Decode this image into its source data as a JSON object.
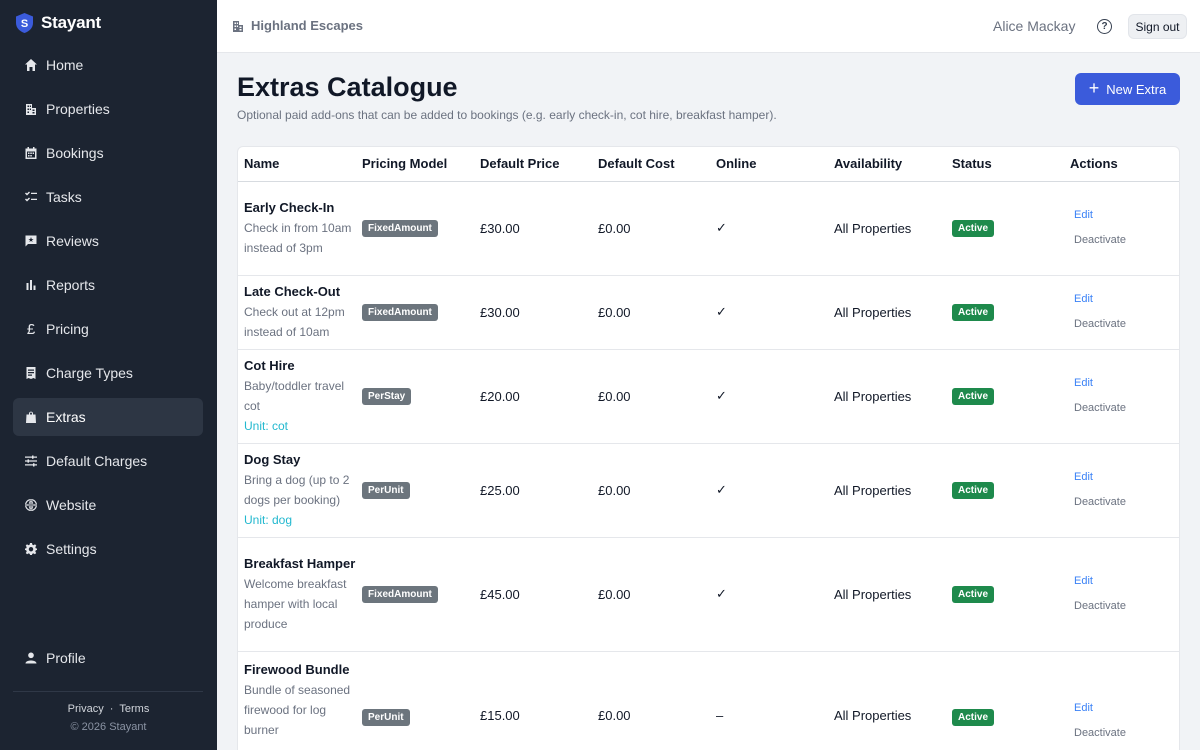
{
  "app": {
    "name": "Stayant"
  },
  "sidebar": {
    "items": [
      {
        "label": "Home",
        "icon": "home-icon"
      },
      {
        "label": "Properties",
        "icon": "building-icon"
      },
      {
        "label": "Bookings",
        "icon": "calendar-icon"
      },
      {
        "label": "Tasks",
        "icon": "checklist-icon"
      },
      {
        "label": "Reviews",
        "icon": "review-icon"
      },
      {
        "label": "Reports",
        "icon": "bar-chart-icon"
      },
      {
        "label": "Pricing",
        "icon": "pound-icon"
      },
      {
        "label": "Charge Types",
        "icon": "receipt-icon"
      },
      {
        "label": "Extras",
        "icon": "bag-icon",
        "active": true
      },
      {
        "label": "Default Charges",
        "icon": "sliders-icon"
      },
      {
        "label": "Website",
        "icon": "globe-icon"
      },
      {
        "label": "Settings",
        "icon": "gear-icon"
      }
    ],
    "profile": "Profile",
    "footer": {
      "privacy": "Privacy",
      "separator": "·",
      "terms": "Terms",
      "copyright": "© 2026 Stayant"
    }
  },
  "topbar": {
    "org": "Highland Escapes",
    "user": "Alice Mackay",
    "help": "?",
    "signout": "Sign out"
  },
  "page": {
    "title": "Extras Catalogue",
    "subtitle": "Optional paid add-ons that can be added to bookings (e.g. early check-in, cot hire, breakfast hamper).",
    "new_button": "New Extra"
  },
  "table": {
    "headers": [
      "Name",
      "Pricing Model",
      "Default Price",
      "Default Cost",
      "Online",
      "Availability",
      "Status",
      "Actions"
    ],
    "rows": [
      {
        "name": "Early Check-In",
        "desc": "Check in from 10am instead of 3pm",
        "unit": "",
        "model": "FixedAmount",
        "price": "£30.00",
        "cost": "£0.00",
        "online": "✓",
        "availability": "All Properties",
        "status": "Active",
        "edit": "Edit",
        "deactivate": "Deactivate"
      },
      {
        "name": "Late Check-Out",
        "desc": "Check out at 12pm instead of 10am",
        "unit": "",
        "model": "FixedAmount",
        "price": "£30.00",
        "cost": "£0.00",
        "online": "✓",
        "availability": "All Properties",
        "status": "Active",
        "edit": "Edit",
        "deactivate": "Deactivate"
      },
      {
        "name": "Cot Hire",
        "desc": "Baby/toddler travel cot",
        "unit": "Unit: cot",
        "model": "PerStay",
        "price": "£20.00",
        "cost": "£0.00",
        "online": "✓",
        "availability": "All Properties",
        "status": "Active",
        "edit": "Edit",
        "deactivate": "Deactivate"
      },
      {
        "name": "Dog Stay",
        "desc": "Bring a dog (up to 2 dogs per booking)",
        "unit": "Unit: dog",
        "model": "PerUnit",
        "price": "£25.00",
        "cost": "£0.00",
        "online": "✓",
        "availability": "All Properties",
        "status": "Active",
        "edit": "Edit",
        "deactivate": "Deactivate"
      },
      {
        "name": "Breakfast Hamper",
        "desc": "Welcome breakfast hamper with local produce",
        "unit": "",
        "model": "FixedAmount",
        "price": "£45.00",
        "cost": "£0.00",
        "online": "✓",
        "availability": "All Properties",
        "status": "Active",
        "edit": "Edit",
        "deactivate": "Deactivate"
      },
      {
        "name": "Firewood Bundle",
        "desc": "Bundle of seasoned firewood for log burner",
        "unit": "",
        "model": "PerUnit",
        "price": "£15.00",
        "cost": "£0.00",
        "online": "–",
        "availability": "All Properties",
        "status": "Active",
        "edit": "Edit",
        "deactivate": "Deactivate"
      }
    ]
  },
  "colors": {
    "sidebar_bg": "#1c2431",
    "primary": "#3b5bdb",
    "active_badge": "#1e8a4c",
    "model_badge": "#6c757d",
    "unit_text": "#22b8cf"
  }
}
